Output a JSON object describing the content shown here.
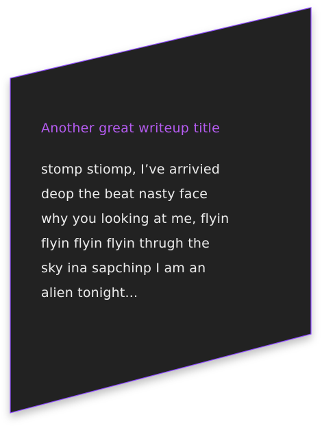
{
  "card": {
    "title": "Another great writeup title",
    "body_lines": [
      "stomp stiomp, I’ve arrivied",
      "deop the beat nasty face",
      "why you looking at me, flyin",
      "flyin flyin flyin thrugh the",
      "sky ina sapchinp I am an",
      "alien tonight..."
    ],
    "background_color": "#212121",
    "border_color": "#8f4dff",
    "title_color": "#b65cf2"
  }
}
